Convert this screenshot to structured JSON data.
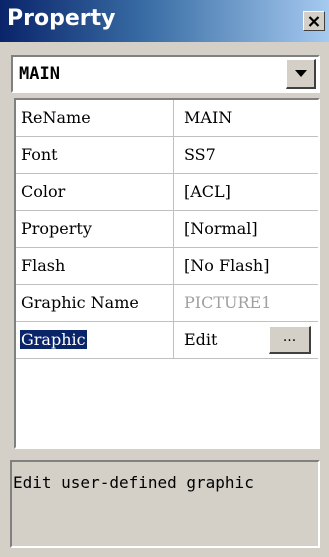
{
  "window": {
    "title": "Property",
    "close_icon": "close-icon"
  },
  "object_selector": {
    "value": "MAIN",
    "dropdown_icon": "chevron-down-icon"
  },
  "properties": [
    {
      "key": "ReName",
      "value": "MAIN"
    },
    {
      "key": "Font",
      "value": "SS7"
    },
    {
      "key": "Color",
      "value": "[ACL]"
    },
    {
      "key": "Property",
      "value": "[Normal]"
    },
    {
      "key": "Flash",
      "value": "[No Flash]"
    },
    {
      "key": "Graphic Name",
      "value": "PICTURE1",
      "disabled": true
    },
    {
      "key": "Graphic",
      "value": "Edit",
      "selected": true,
      "button_label": "..."
    }
  ],
  "description": "Edit user-defined graphic",
  "colors": {
    "title_start": "#0a246a",
    "title_end": "#a6caf0",
    "selection": "#0a246a",
    "face": "#d4d0c8"
  }
}
